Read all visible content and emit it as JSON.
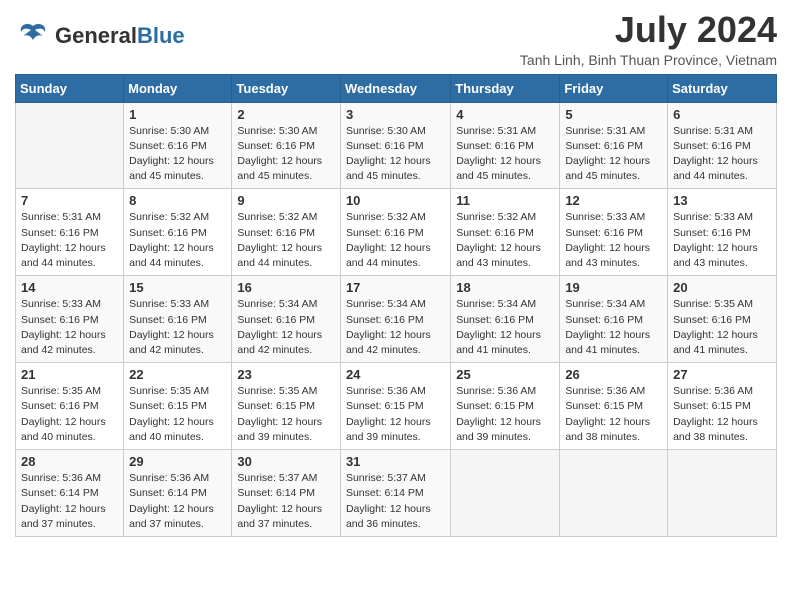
{
  "header": {
    "logo_general": "General",
    "logo_blue": "Blue",
    "month_year": "July 2024",
    "location": "Tanh Linh, Binh Thuan Province, Vietnam"
  },
  "weekdays": [
    "Sunday",
    "Monday",
    "Tuesday",
    "Wednesday",
    "Thursday",
    "Friday",
    "Saturday"
  ],
  "weeks": [
    [
      {
        "day": "",
        "info": ""
      },
      {
        "day": "1",
        "info": "Sunrise: 5:30 AM\nSunset: 6:16 PM\nDaylight: 12 hours\nand 45 minutes."
      },
      {
        "day": "2",
        "info": "Sunrise: 5:30 AM\nSunset: 6:16 PM\nDaylight: 12 hours\nand 45 minutes."
      },
      {
        "day": "3",
        "info": "Sunrise: 5:30 AM\nSunset: 6:16 PM\nDaylight: 12 hours\nand 45 minutes."
      },
      {
        "day": "4",
        "info": "Sunrise: 5:31 AM\nSunset: 6:16 PM\nDaylight: 12 hours\nand 45 minutes."
      },
      {
        "day": "5",
        "info": "Sunrise: 5:31 AM\nSunset: 6:16 PM\nDaylight: 12 hours\nand 45 minutes."
      },
      {
        "day": "6",
        "info": "Sunrise: 5:31 AM\nSunset: 6:16 PM\nDaylight: 12 hours\nand 44 minutes."
      }
    ],
    [
      {
        "day": "7",
        "info": "Sunrise: 5:31 AM\nSunset: 6:16 PM\nDaylight: 12 hours\nand 44 minutes."
      },
      {
        "day": "8",
        "info": "Sunrise: 5:32 AM\nSunset: 6:16 PM\nDaylight: 12 hours\nand 44 minutes."
      },
      {
        "day": "9",
        "info": "Sunrise: 5:32 AM\nSunset: 6:16 PM\nDaylight: 12 hours\nand 44 minutes."
      },
      {
        "day": "10",
        "info": "Sunrise: 5:32 AM\nSunset: 6:16 PM\nDaylight: 12 hours\nand 44 minutes."
      },
      {
        "day": "11",
        "info": "Sunrise: 5:32 AM\nSunset: 6:16 PM\nDaylight: 12 hours\nand 43 minutes."
      },
      {
        "day": "12",
        "info": "Sunrise: 5:33 AM\nSunset: 6:16 PM\nDaylight: 12 hours\nand 43 minutes."
      },
      {
        "day": "13",
        "info": "Sunrise: 5:33 AM\nSunset: 6:16 PM\nDaylight: 12 hours\nand 43 minutes."
      }
    ],
    [
      {
        "day": "14",
        "info": "Sunrise: 5:33 AM\nSunset: 6:16 PM\nDaylight: 12 hours\nand 42 minutes."
      },
      {
        "day": "15",
        "info": "Sunrise: 5:33 AM\nSunset: 6:16 PM\nDaylight: 12 hours\nand 42 minutes."
      },
      {
        "day": "16",
        "info": "Sunrise: 5:34 AM\nSunset: 6:16 PM\nDaylight: 12 hours\nand 42 minutes."
      },
      {
        "day": "17",
        "info": "Sunrise: 5:34 AM\nSunset: 6:16 PM\nDaylight: 12 hours\nand 42 minutes."
      },
      {
        "day": "18",
        "info": "Sunrise: 5:34 AM\nSunset: 6:16 PM\nDaylight: 12 hours\nand 41 minutes."
      },
      {
        "day": "19",
        "info": "Sunrise: 5:34 AM\nSunset: 6:16 PM\nDaylight: 12 hours\nand 41 minutes."
      },
      {
        "day": "20",
        "info": "Sunrise: 5:35 AM\nSunset: 6:16 PM\nDaylight: 12 hours\nand 41 minutes."
      }
    ],
    [
      {
        "day": "21",
        "info": "Sunrise: 5:35 AM\nSunset: 6:16 PM\nDaylight: 12 hours\nand 40 minutes."
      },
      {
        "day": "22",
        "info": "Sunrise: 5:35 AM\nSunset: 6:15 PM\nDaylight: 12 hours\nand 40 minutes."
      },
      {
        "day": "23",
        "info": "Sunrise: 5:35 AM\nSunset: 6:15 PM\nDaylight: 12 hours\nand 39 minutes."
      },
      {
        "day": "24",
        "info": "Sunrise: 5:36 AM\nSunset: 6:15 PM\nDaylight: 12 hours\nand 39 minutes."
      },
      {
        "day": "25",
        "info": "Sunrise: 5:36 AM\nSunset: 6:15 PM\nDaylight: 12 hours\nand 39 minutes."
      },
      {
        "day": "26",
        "info": "Sunrise: 5:36 AM\nSunset: 6:15 PM\nDaylight: 12 hours\nand 38 minutes."
      },
      {
        "day": "27",
        "info": "Sunrise: 5:36 AM\nSunset: 6:15 PM\nDaylight: 12 hours\nand 38 minutes."
      }
    ],
    [
      {
        "day": "28",
        "info": "Sunrise: 5:36 AM\nSunset: 6:14 PM\nDaylight: 12 hours\nand 37 minutes."
      },
      {
        "day": "29",
        "info": "Sunrise: 5:36 AM\nSunset: 6:14 PM\nDaylight: 12 hours\nand 37 minutes."
      },
      {
        "day": "30",
        "info": "Sunrise: 5:37 AM\nSunset: 6:14 PM\nDaylight: 12 hours\nand 37 minutes."
      },
      {
        "day": "31",
        "info": "Sunrise: 5:37 AM\nSunset: 6:14 PM\nDaylight: 12 hours\nand 36 minutes."
      },
      {
        "day": "",
        "info": ""
      },
      {
        "day": "",
        "info": ""
      },
      {
        "day": "",
        "info": ""
      }
    ]
  ]
}
